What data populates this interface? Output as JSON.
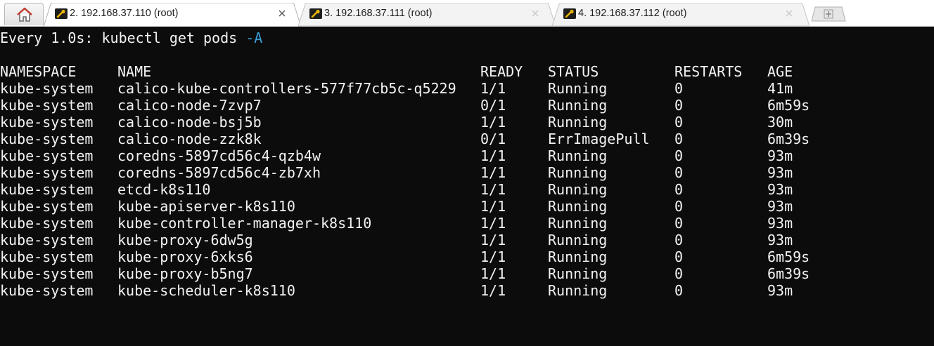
{
  "tabs": [
    {
      "label": "2. 192.168.37.110 (root)",
      "active": true
    },
    {
      "label": "3. 192.168.37.111 (root)",
      "active": false
    },
    {
      "label": "4. 192.168.37.112 (root)",
      "active": false
    }
  ],
  "icons": {
    "home": "home-icon",
    "session": "wrench-icon",
    "close": "close-icon",
    "new_tab": "plus-icon"
  },
  "terminal": {
    "watch_prefix": "Every 1.0s: kubectl get pods ",
    "watch_flag": "-A",
    "headers": [
      "NAMESPACE",
      "NAME",
      "READY",
      "STATUS",
      "RESTARTS",
      "AGE"
    ],
    "rows": [
      [
        "kube-system",
        "calico-kube-controllers-577f77cb5c-q5229",
        "1/1",
        "Running",
        "0",
        "41m"
      ],
      [
        "kube-system",
        "calico-node-7zvp7",
        "0/1",
        "Running",
        "0",
        "6m59s"
      ],
      [
        "kube-system",
        "calico-node-bsj5b",
        "1/1",
        "Running",
        "0",
        "30m"
      ],
      [
        "kube-system",
        "calico-node-zzk8k",
        "0/1",
        "ErrImagePull",
        "0",
        "6m39s"
      ],
      [
        "kube-system",
        "coredns-5897cd56c4-qzb4w",
        "1/1",
        "Running",
        "0",
        "93m"
      ],
      [
        "kube-system",
        "coredns-5897cd56c4-zb7xh",
        "1/1",
        "Running",
        "0",
        "93m"
      ],
      [
        "kube-system",
        "etcd-k8s110",
        "1/1",
        "Running",
        "0",
        "93m"
      ],
      [
        "kube-system",
        "kube-apiserver-k8s110",
        "1/1",
        "Running",
        "0",
        "93m"
      ],
      [
        "kube-system",
        "kube-controller-manager-k8s110",
        "1/1",
        "Running",
        "0",
        "93m"
      ],
      [
        "kube-system",
        "kube-proxy-6dw5g",
        "1/1",
        "Running",
        "0",
        "93m"
      ],
      [
        "kube-system",
        "kube-proxy-6xks6",
        "1/1",
        "Running",
        "0",
        "6m59s"
      ],
      [
        "kube-system",
        "kube-proxy-b5ng7",
        "1/1",
        "Running",
        "0",
        "6m39s"
      ],
      [
        "kube-system",
        "kube-scheduler-k8s110",
        "1/1",
        "Running",
        "0",
        "93m"
      ]
    ]
  },
  "colors": {
    "terminal_bg": "#0c0c0c",
    "terminal_fg": "#f2f2f2",
    "flag": "#3a9fd8",
    "tab_active": "#ffffff",
    "tab_inactive": "#f2f2f2"
  }
}
